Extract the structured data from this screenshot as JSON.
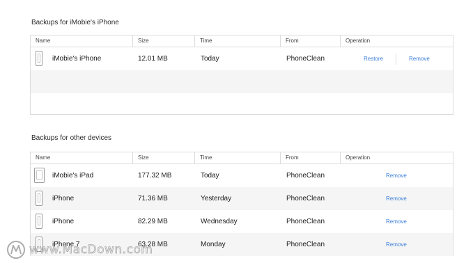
{
  "section1": {
    "title": "Backups for iMobie's iPhone",
    "columns": [
      "Name",
      "Size",
      "Time",
      "From",
      "Operation"
    ],
    "rows": [
      {
        "name": "iMobie's iPhone",
        "size": "12.01 MB",
        "time": "Today",
        "from": "PhoneClean",
        "restore": "Restore",
        "remove": "Remove"
      }
    ]
  },
  "section2": {
    "title": "Backups for other devices",
    "columns": [
      "Name",
      "Size",
      "Time",
      "From",
      "Operation"
    ],
    "rows": [
      {
        "name": "iMobie's iPad",
        "size": "177.32 MB",
        "time": "Today",
        "from": "PhoneClean",
        "remove": "Remove",
        "icon": "ipad-icon"
      },
      {
        "name": "iPhone",
        "size": "71.36 MB",
        "time": "Yesterday",
        "from": "PhoneClean",
        "remove": "Remove",
        "icon": "iphone-icon"
      },
      {
        "name": "iPhone",
        "size": "82.29 MB",
        "time": "Wednesday",
        "from": "PhoneClean",
        "remove": "Remove",
        "icon": "iphone-icon"
      },
      {
        "name": "iPhone 7",
        "size": "63.28 MB",
        "time": "Monday",
        "from": "PhoneClean",
        "remove": "Remove",
        "icon": "iphone-icon"
      }
    ]
  },
  "watermark": {
    "text": "www.MacDown.com"
  },
  "colors": {
    "link": "#3b7fd9",
    "border": "#dcdcdc",
    "alt_row": "#f5f5f5"
  }
}
